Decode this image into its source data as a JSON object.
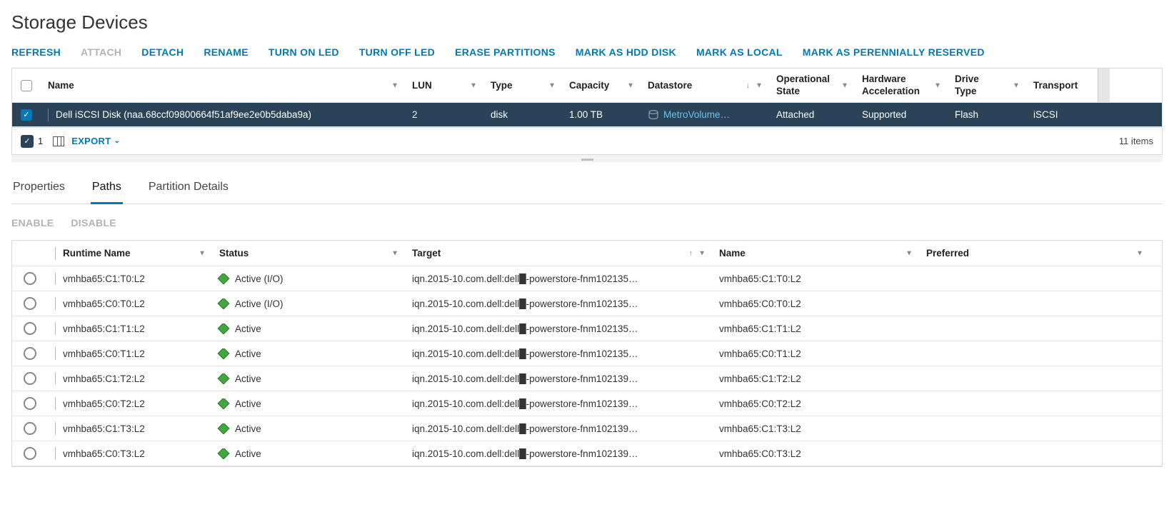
{
  "title": "Storage Devices",
  "actions": [
    {
      "id": "refresh",
      "label": "REFRESH",
      "disabled": false
    },
    {
      "id": "attach",
      "label": "ATTACH",
      "disabled": true
    },
    {
      "id": "detach",
      "label": "DETACH",
      "disabled": false
    },
    {
      "id": "rename",
      "label": "RENAME",
      "disabled": false
    },
    {
      "id": "turn-on-led",
      "label": "TURN ON LED",
      "disabled": false
    },
    {
      "id": "turn-off-led",
      "label": "TURN OFF LED",
      "disabled": false
    },
    {
      "id": "erase-partitions",
      "label": "ERASE PARTITIONS",
      "disabled": false
    },
    {
      "id": "mark-hdd",
      "label": "MARK AS HDD DISK",
      "disabled": false
    },
    {
      "id": "mark-local",
      "label": "MARK AS LOCAL",
      "disabled": false
    },
    {
      "id": "mark-perennial",
      "label": "MARK AS PERENNIALLY RESERVED",
      "disabled": false
    }
  ],
  "devices": {
    "columns": {
      "name": "Name",
      "lun": "LUN",
      "type": "Type",
      "capacity": "Capacity",
      "datastore": "Datastore",
      "op_state": "Operational State",
      "hw_accel": "Hardware Acceleration",
      "drive_type": "Drive Type",
      "transport": "Transport"
    },
    "rows": [
      {
        "selected": true,
        "name": "Dell iSCSI Disk (naa.68ccf09800664f51af9ee2e0b5daba9a)",
        "lun": "2",
        "type": "disk",
        "capacity": "1.00 TB",
        "datastore": "MetroVolume…",
        "op_state": "Attached",
        "hw_accel": "Supported",
        "drive_type": "Flash",
        "transport": "iSCSI"
      }
    ],
    "footer": {
      "selected_count": "1",
      "export_label": "EXPORT",
      "items_text": "11 items"
    }
  },
  "detail_tabs": {
    "properties": "Properties",
    "paths": "Paths",
    "partition": "Partition Details",
    "active": "paths"
  },
  "path_actions": {
    "enable": "ENABLE",
    "disable": "DISABLE"
  },
  "paths": {
    "columns": {
      "runtime": "Runtime Name",
      "status": "Status",
      "target": "Target",
      "name": "Name",
      "preferred": "Preferred"
    },
    "rows": [
      {
        "runtime": "vmhba65:C1:T0:L2",
        "status": "Active (I/O)",
        "target": "iqn.2015-10.com.dell:dell█-powerstore-fnm102135…",
        "name": "vmhba65:C1:T0:L2",
        "preferred": ""
      },
      {
        "runtime": "vmhba65:C0:T0:L2",
        "status": "Active (I/O)",
        "target": "iqn.2015-10.com.dell:dell█-powerstore-fnm102135…",
        "name": "vmhba65:C0:T0:L2",
        "preferred": ""
      },
      {
        "runtime": "vmhba65:C1:T1:L2",
        "status": "Active",
        "target": "iqn.2015-10.com.dell:dell█-powerstore-fnm102135…",
        "name": "vmhba65:C1:T1:L2",
        "preferred": ""
      },
      {
        "runtime": "vmhba65:C0:T1:L2",
        "status": "Active",
        "target": "iqn.2015-10.com.dell:dell█-powerstore-fnm102135…",
        "name": "vmhba65:C0:T1:L2",
        "preferred": ""
      },
      {
        "runtime": "vmhba65:C1:T2:L2",
        "status": "Active",
        "target": "iqn.2015-10.com.dell:dell█-powerstore-fnm102139…",
        "name": "vmhba65:C1:T2:L2",
        "preferred": ""
      },
      {
        "runtime": "vmhba65:C0:T2:L2",
        "status": "Active",
        "target": "iqn.2015-10.com.dell:dell█-powerstore-fnm102139…",
        "name": "vmhba65:C0:T2:L2",
        "preferred": ""
      },
      {
        "runtime": "vmhba65:C1:T3:L2",
        "status": "Active",
        "target": "iqn.2015-10.com.dell:dell█-powerstore-fnm102139…",
        "name": "vmhba65:C1:T3:L2",
        "preferred": ""
      },
      {
        "runtime": "vmhba65:C0:T3:L2",
        "status": "Active",
        "target": "iqn.2015-10.com.dell:dell█-powerstore-fnm102139…",
        "name": "vmhba65:C0:T3:L2",
        "preferred": ""
      }
    ]
  }
}
